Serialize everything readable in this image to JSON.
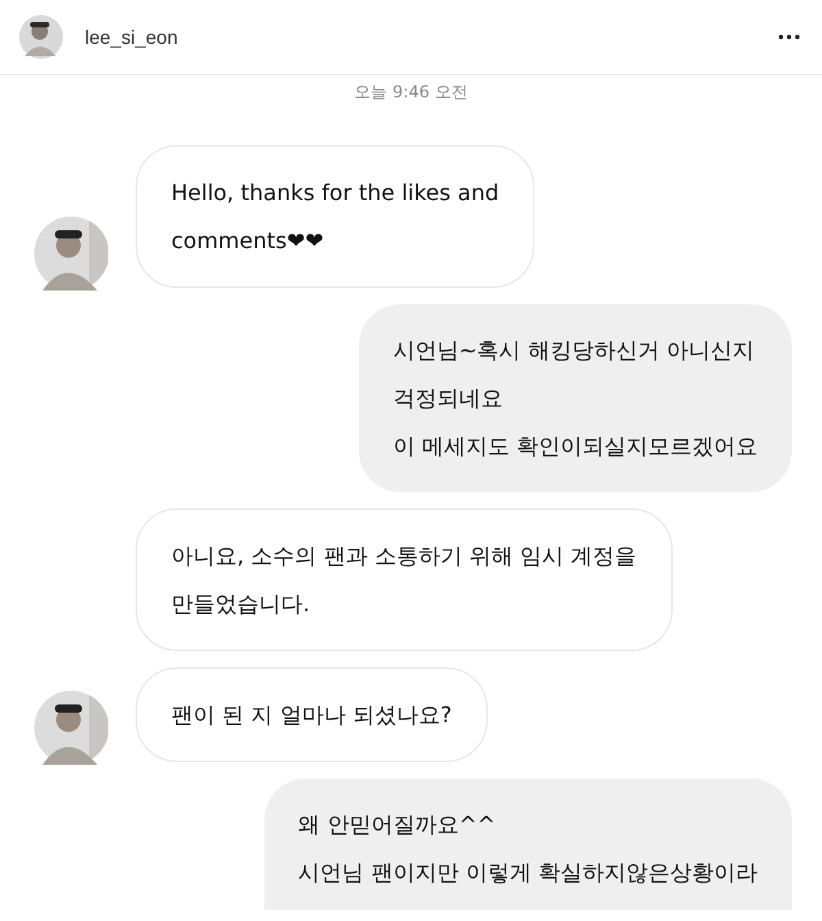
{
  "header": {
    "username": "lee_si_eon"
  },
  "timestamp": "오늘 9:46 오전",
  "messages": [
    {
      "kind": "received",
      "show_avatar": true,
      "lines": [
        "Hello, thanks for the likes and",
        "comments❤❤"
      ]
    },
    {
      "kind": "sent",
      "lines": [
        "시언님~혹시 해킹당하신거 아니신지",
        "걱정되네요",
        "이 메세지도 확인이되실지모르겠어요"
      ]
    },
    {
      "kind": "received",
      "show_avatar": false,
      "lines": [
        "아니요, 소수의 팬과 소통하기 위해 임시 계정을",
        "만들었습니다."
      ]
    },
    {
      "kind": "received",
      "show_avatar": true,
      "lines": [
        "팬이 된 지 얼마나 되셨나요?"
      ]
    },
    {
      "kind": "sent",
      "lines": [
        "왜 안믿어질까요^^",
        "시언님 팬이지만 이렇게 확실하지않은상황이라"
      ]
    }
  ]
}
